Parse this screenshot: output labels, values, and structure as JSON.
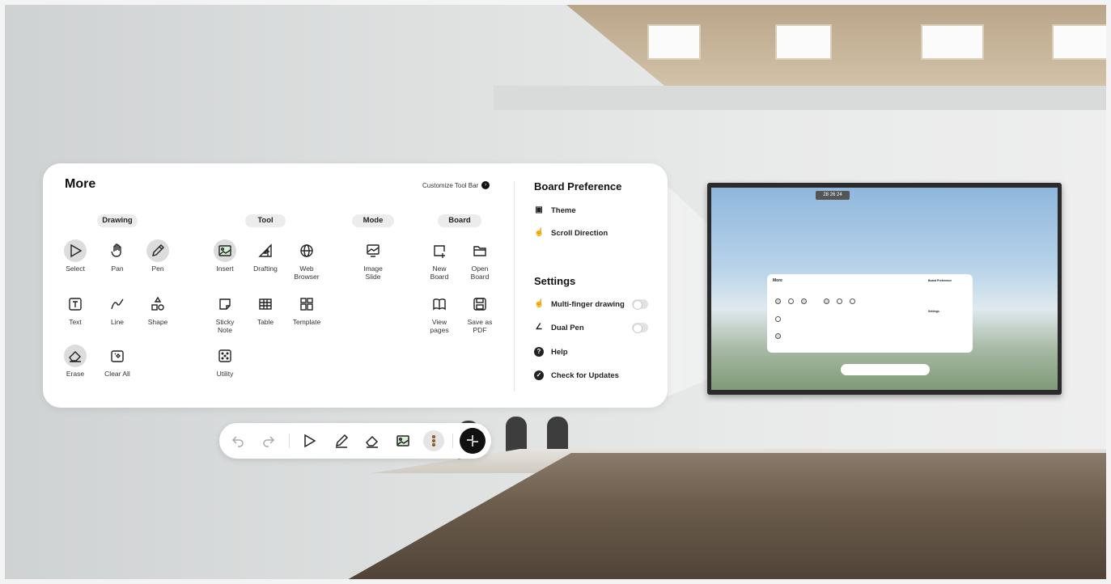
{
  "panel": {
    "title": "More",
    "customize_label": "Customize Tool Bar",
    "sections": {
      "drawing": "Drawing",
      "tool": "Tool",
      "mode": "Mode",
      "board": "Board"
    },
    "tools": {
      "select": "Select",
      "pan": "Pan",
      "pen": "Pen",
      "text": "Text",
      "line": "Line",
      "shape": "Shape",
      "erase": "Erase",
      "clear_all": "Clear All",
      "insert": "Insert",
      "drafting": "Drafting",
      "web_browser": "Web\nBrowser",
      "sticky_note": "Sticky\nNote",
      "table": "Table",
      "template": "Template",
      "utility": "Utility",
      "image_slide": "Image\nSlide",
      "new_board": "New\nBoard",
      "open_board": "Open\nBoard",
      "view_pages": "View\npages",
      "save_as_pdf": "Save as\nPDF"
    }
  },
  "preferences": {
    "board_title": "Board Preference",
    "theme": "Theme",
    "scroll_direction": "Scroll Direction",
    "settings_title": "Settings",
    "multi_finger": "Multi-finger drawing",
    "dual_pen": "Dual Pen",
    "help": "Help",
    "check_updates": "Check for Updates",
    "multi_finger_on": false,
    "dual_pen_on": false
  },
  "display": {
    "clock": "28 26 24"
  },
  "colors": {
    "accent_dark": "#111111",
    "selected_bg": "#dcdcdc",
    "panel_bg": "#ffffff"
  }
}
